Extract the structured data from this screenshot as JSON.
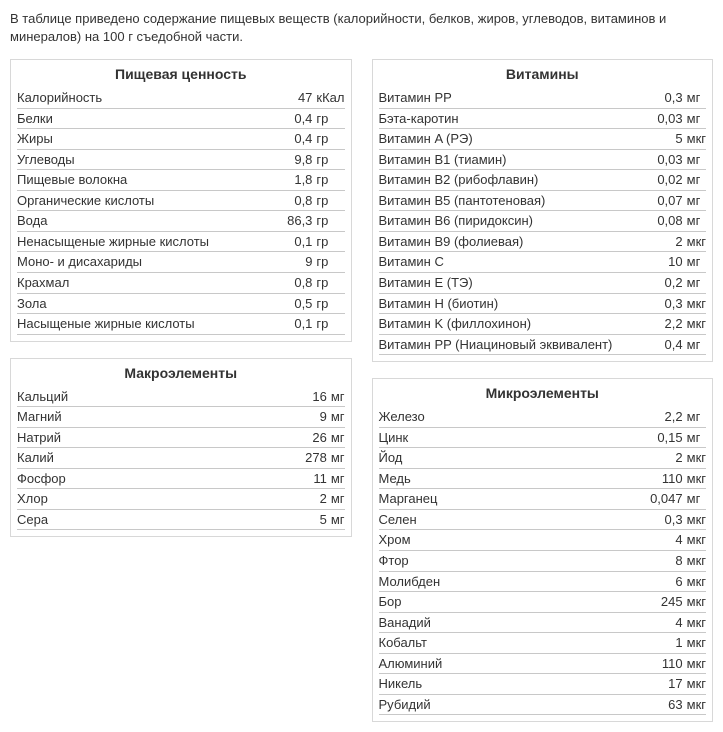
{
  "intro": "В таблице приведено содержание пищевых веществ (калорийности, белков, жиров, углеводов, витаминов и минералов) на 100 г съедобной части.",
  "panels": {
    "nutrition": {
      "title": "Пищевая ценность",
      "rows": [
        {
          "name": "Калорийность",
          "value": "47",
          "unit": "кКал"
        },
        {
          "name": "Белки",
          "value": "0,4",
          "unit": "гр"
        },
        {
          "name": "Жиры",
          "value": "0,4",
          "unit": "гр"
        },
        {
          "name": "Углеводы",
          "value": "9,8",
          "unit": "гр"
        },
        {
          "name": "Пищевые волокна",
          "value": "1,8",
          "unit": "гр"
        },
        {
          "name": "Органические кислоты",
          "value": "0,8",
          "unit": "гр"
        },
        {
          "name": "Вода",
          "value": "86,3",
          "unit": "гр"
        },
        {
          "name": "Ненасыщеные жирные кислоты",
          "value": "0,1",
          "unit": "гр"
        },
        {
          "name": "Моно- и дисахариды",
          "value": "9",
          "unit": "гр"
        },
        {
          "name": "Крахмал",
          "value": "0,8",
          "unit": "гр"
        },
        {
          "name": "Зола",
          "value": "0,5",
          "unit": "гр"
        },
        {
          "name": "Насыщеные жирные кислоты",
          "value": "0,1",
          "unit": "гр"
        }
      ]
    },
    "vitamins": {
      "title": "Витамины",
      "rows": [
        {
          "name": "Витамин PP",
          "value": "0,3",
          "unit": "мг"
        },
        {
          "name": "Бэта-каротин",
          "value": "0,03",
          "unit": "мг"
        },
        {
          "name": "Витамин A (РЭ)",
          "value": "5",
          "unit": "мкг"
        },
        {
          "name": "Витамин B1 (тиамин)",
          "value": "0,03",
          "unit": "мг"
        },
        {
          "name": "Витамин B2 (рибофлавин)",
          "value": "0,02",
          "unit": "мг"
        },
        {
          "name": "Витамин B5 (пантотеновая)",
          "value": "0,07",
          "unit": "мг"
        },
        {
          "name": "Витамин B6 (пиридоксин)",
          "value": "0,08",
          "unit": "мг"
        },
        {
          "name": "Витамин B9 (фолиевая)",
          "value": "2",
          "unit": "мкг"
        },
        {
          "name": "Витамин C",
          "value": "10",
          "unit": "мг"
        },
        {
          "name": "Витамин E (ТЭ)",
          "value": "0,2",
          "unit": "мг"
        },
        {
          "name": "Витамин H (биотин)",
          "value": "0,3",
          "unit": "мкг"
        },
        {
          "name": "Витамин K (филлохинон)",
          "value": "2,2",
          "unit": "мкг"
        },
        {
          "name": "Витамин PP (Ниациновый эквивалент)",
          "value": "0,4",
          "unit": "мг"
        }
      ]
    },
    "macro": {
      "title": "Макроэлементы",
      "rows": [
        {
          "name": "Кальций",
          "value": "16",
          "unit": "мг"
        },
        {
          "name": "Магний",
          "value": "9",
          "unit": "мг"
        },
        {
          "name": "Натрий",
          "value": "26",
          "unit": "мг"
        },
        {
          "name": "Калий",
          "value": "278",
          "unit": "мг"
        },
        {
          "name": "Фосфор",
          "value": "11",
          "unit": "мг"
        },
        {
          "name": "Хлор",
          "value": "2",
          "unit": "мг"
        },
        {
          "name": "Сера",
          "value": "5",
          "unit": "мг"
        }
      ]
    },
    "micro": {
      "title": "Микроэлементы",
      "rows": [
        {
          "name": "Железо",
          "value": "2,2",
          "unit": "мг"
        },
        {
          "name": "Цинк",
          "value": "0,15",
          "unit": "мг"
        },
        {
          "name": "Йод",
          "value": "2",
          "unit": "мкг"
        },
        {
          "name": "Медь",
          "value": "110",
          "unit": "мкг"
        },
        {
          "name": "Марганец",
          "value": "0,047",
          "unit": "мг"
        },
        {
          "name": "Селен",
          "value": "0,3",
          "unit": "мкг"
        },
        {
          "name": "Хром",
          "value": "4",
          "unit": "мкг"
        },
        {
          "name": "Фтор",
          "value": "8",
          "unit": "мкг"
        },
        {
          "name": "Молибден",
          "value": "6",
          "unit": "мкг"
        },
        {
          "name": "Бор",
          "value": "245",
          "unit": "мкг"
        },
        {
          "name": "Ванадий",
          "value": "4",
          "unit": "мкг"
        },
        {
          "name": "Кобальт",
          "value": "1",
          "unit": "мкг"
        },
        {
          "name": "Алюминий",
          "value": "110",
          "unit": "мкг"
        },
        {
          "name": "Никель",
          "value": "17",
          "unit": "мкг"
        },
        {
          "name": "Рубидий",
          "value": "63",
          "unit": "мкг"
        }
      ]
    }
  }
}
